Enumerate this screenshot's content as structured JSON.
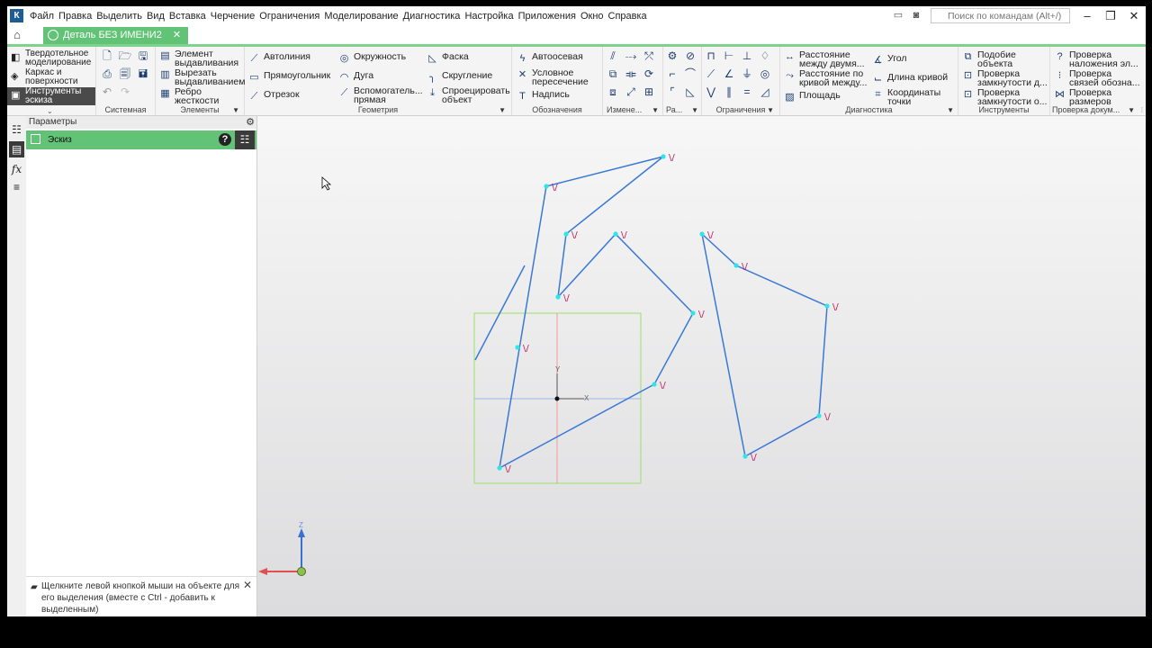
{
  "menu": {
    "items": [
      "Файл",
      "Правка",
      "Выделить",
      "Вид",
      "Вставка",
      "Черчение",
      "Ограничения",
      "Моделирование",
      "Диагностика",
      "Настройка",
      "Приложения",
      "Окно",
      "Справка"
    ],
    "search_placeholder": "Поиск по командам (Alt+/)"
  },
  "tab": {
    "title": "Деталь БЕЗ ИМЕНИ2"
  },
  "modes": [
    {
      "label": "Твердотельное\nмоделирование",
      "icon": "solid-icon"
    },
    {
      "label": "Каркас и\nповерхности",
      "icon": "wireframe-icon"
    },
    {
      "label": "Инструменты\nэскиза",
      "icon": "sketch-tools-icon"
    }
  ],
  "ribbon": {
    "groups": {
      "system": "Системная",
      "elements": "Элементы",
      "geometry": "Геометрия",
      "designations": "Обозначения",
      "modify": "Измене...",
      "ra": "Ра...",
      "constraints": "Ограничения",
      "diagnostics": "Диагностика",
      "instruments": "Инструменты",
      "doccheck": "Проверка докум..."
    },
    "elements": [
      "Элемент\nвыдавливания",
      "Вырезать\nвыдавливанием",
      "Ребро\nжесткости"
    ],
    "geometry": [
      "Автолиния",
      "Прямоугольник",
      "Отрезок",
      "Окружность",
      "Дуга",
      "Вспомогатель...\nпрямая",
      "Фаска",
      "Скругление",
      "Спроецировать\nобъект"
    ],
    "designations": [
      "Автоосевая",
      "Условное\nпересечение",
      "Надпись"
    ],
    "diagnostics": [
      "Расстояние\nмежду двумя...",
      "Расстояние по\nкривой между...",
      "Площадь",
      "Угол",
      "Длина кривой",
      "Координаты\nточки"
    ],
    "instruments": [
      "Подобие\nобъекта",
      "Проверка\nзамкнутости д...",
      "Проверка\nзамкнутости о..."
    ],
    "doccheck": [
      "Проверка\nналожения эл...",
      "Проверка\nсвязей обозна...",
      "Проверка\nразмеров"
    ]
  },
  "panel": {
    "title": "Параметры",
    "sketch_label": "Эскиз",
    "hint": "Щелкните левой кнопкой мыши на объекте для его выделения (вместе с Ctrl - добавить к выделенным)"
  },
  "viewport": {
    "axis_x": "X",
    "axis_y": "Y",
    "axis_z": "Z",
    "constraint_mark": "\\/",
    "colors": {
      "line": "#3a78d6",
      "point": "#2ee6e6",
      "constraint": "#c0185a",
      "bbox": "#9be06a"
    }
  }
}
